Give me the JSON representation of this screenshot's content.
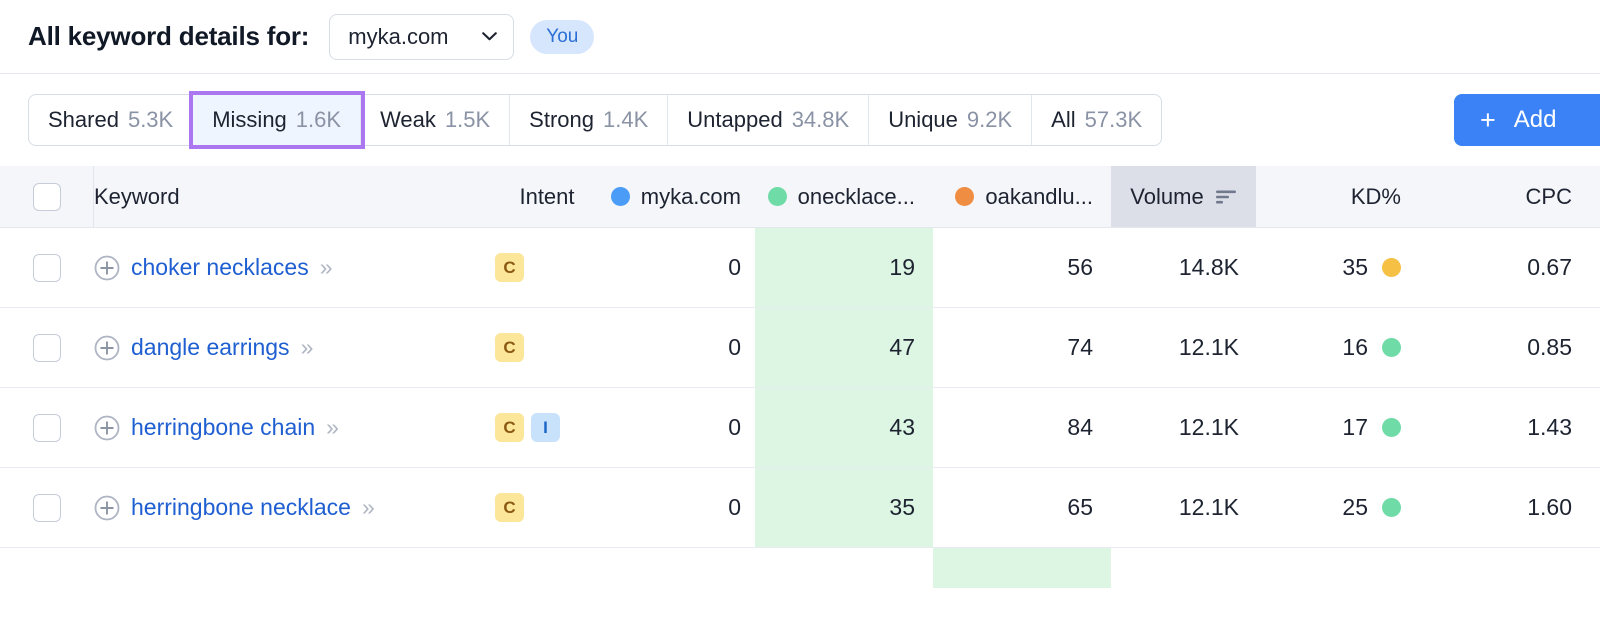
{
  "header": {
    "title": "All keyword details for:",
    "domain_value": "myka.com",
    "you_badge": "You"
  },
  "tabs": [
    {
      "label": "Shared",
      "count": "5.3K",
      "active": false
    },
    {
      "label": "Missing",
      "count": "1.6K",
      "active": true
    },
    {
      "label": "Weak",
      "count": "1.5K",
      "active": false
    },
    {
      "label": "Strong",
      "count": "1.4K",
      "active": false
    },
    {
      "label": "Untapped",
      "count": "34.8K",
      "active": false
    },
    {
      "label": "Unique",
      "count": "9.2K",
      "active": false
    },
    {
      "label": "All",
      "count": "57.3K",
      "active": false
    }
  ],
  "add_button": {
    "label": "Add",
    "icon": "plus-icon"
  },
  "table": {
    "columns": {
      "keyword": "Keyword",
      "intent": "Intent",
      "myka": "myka.com",
      "onecklace": "onecklace...",
      "oakandlu": "oakandlu...",
      "volume": "Volume",
      "kd": "KD%",
      "cpc": "CPC"
    },
    "column_dot_colors": {
      "myka": "#4a9cf6",
      "onecklace": "#6fdba6",
      "oakandlu": "#ef8e42"
    },
    "sorted_column": "volume",
    "rows": [
      {
        "keyword": "choker necklaces",
        "intent": [
          "C"
        ],
        "myka": "0",
        "onecklace": "19",
        "oakandlu": "56",
        "volume": "14.8K",
        "kd": "35",
        "kd_color": "#f5c044",
        "cpc": "0.67",
        "highlight": "onecklace"
      },
      {
        "keyword": "dangle earrings",
        "intent": [
          "C"
        ],
        "myka": "0",
        "onecklace": "47",
        "oakandlu": "74",
        "volume": "12.1K",
        "kd": "16",
        "kd_color": "#6fdba6",
        "cpc": "0.85",
        "highlight": "onecklace"
      },
      {
        "keyword": "herringbone chain",
        "intent": [
          "C",
          "I"
        ],
        "myka": "0",
        "onecklace": "43",
        "oakandlu": "84",
        "volume": "12.1K",
        "kd": "17",
        "kd_color": "#6fdba6",
        "cpc": "1.43",
        "highlight": "onecklace"
      },
      {
        "keyword": "herringbone necklace",
        "intent": [
          "C"
        ],
        "myka": "0",
        "onecklace": "35",
        "oakandlu": "65",
        "volume": "12.1K",
        "kd": "25",
        "kd_color": "#6fdba6",
        "cpc": "1.60",
        "highlight": "onecklace"
      },
      {
        "keyword": "",
        "intent": [],
        "myka": "",
        "onecklace": "",
        "oakandlu": "",
        "volume": "",
        "kd": "",
        "kd_color": "",
        "cpc": "",
        "highlight": "oakandlu",
        "partial": true
      }
    ]
  },
  "colors": {
    "accent_blue": "#3b82f6",
    "active_tab_outline": "#ab77f0",
    "active_tab_bg": "#eff5fe",
    "link_blue": "#1f5fd1",
    "row_highlight_green": "#ddf6e4",
    "sorted_header_bg": "#dcdee8"
  }
}
